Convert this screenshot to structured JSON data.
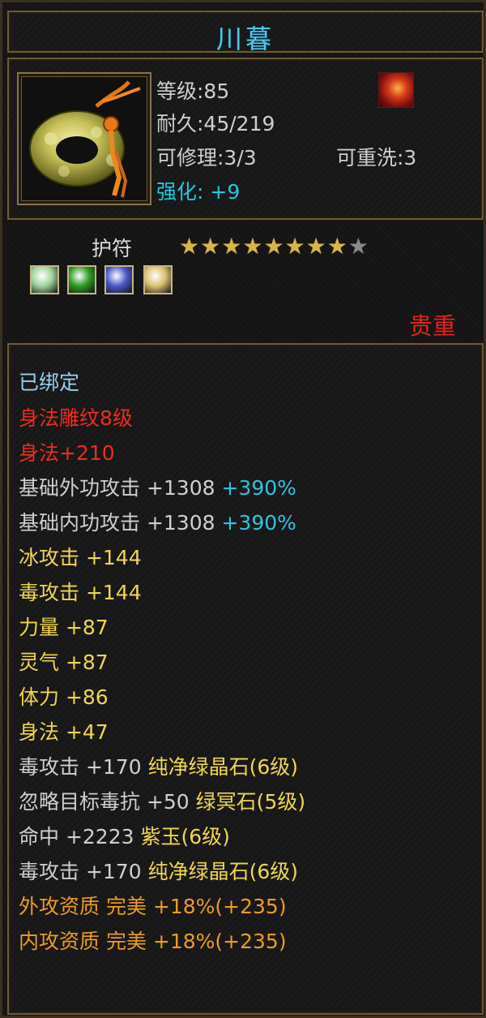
{
  "item": {
    "name": "川暮",
    "level": "等级:85",
    "durability": "耐久:45/219",
    "repair": "可修理:3/3",
    "rewash": "可重洗:3",
    "enhance_label": "强化:",
    "enhance_value": "+9",
    "type": "护符",
    "stars_filled": 8,
    "stars_total": 9,
    "rarity": "贵重",
    "icon": "jade-ring-amulet-icon",
    "badge_icon": "fire-phoenix-badge-icon"
  },
  "gems": [
    {
      "icon": "white-gem-icon",
      "color": "#9fd49a"
    },
    {
      "icon": "green-gem-icon",
      "color": "#2e9b22"
    },
    {
      "icon": "blue-gem-icon",
      "color": "#4a58c8"
    },
    {
      "icon": "yellow-gem-icon",
      "color": "#d9c070"
    }
  ],
  "stats": {
    "bound": "已绑定",
    "engrave": "身法雕纹8级",
    "engrave_bonus": "身法+210",
    "outer_atk": "基础外功攻击 +1308",
    "outer_atk_pct": "+390%",
    "inner_atk": "基础内功攻击 +1308",
    "inner_atk_pct": "+390%",
    "ice_atk": "冰攻击 +144",
    "poison_atk": "毒攻击 +144",
    "strength": "力量 +87",
    "spirit": "灵气 +87",
    "stamina": "体力 +86",
    "agility": "身法 +47",
    "gem1_stat": "毒攻击 +170",
    "gem1_name": "纯净绿晶石(6级)",
    "gem2_stat": "忽略目标毒抗 +50",
    "gem2_name": "绿冥石(5级)",
    "gem3_stat": "命中 +2223",
    "gem3_name": "紫玉(6级)",
    "gem4_stat": "毒攻击 +170",
    "gem4_name": "纯净绿晶石(6级)",
    "outer_quality": "外攻资质  完美 +18%(+235)",
    "inner_quality": "内攻资质  完美 +18%(+235)"
  }
}
